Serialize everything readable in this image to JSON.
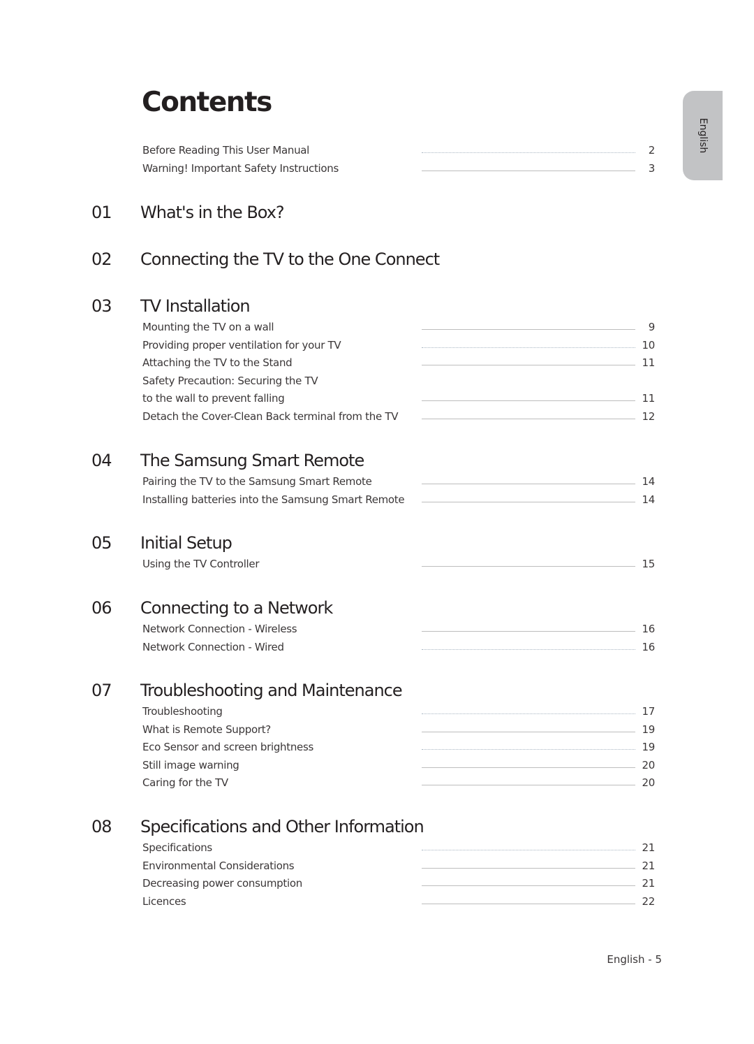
{
  "page": {
    "title": "Contents",
    "language_tab": "English",
    "footer": "English - 5"
  },
  "intro_entries": [
    {
      "label": "Before Reading This User Manual",
      "page": "2"
    },
    {
      "label": "Warning! Important Safety Instructions",
      "page": "3"
    }
  ],
  "chapters": [
    {
      "number": "01",
      "title": "What's in the Box?",
      "entries": []
    },
    {
      "number": "02",
      "title": "Connecting the TV to the One Connect",
      "entries": []
    },
    {
      "number": "03",
      "title": "TV Installation",
      "entries": [
        {
          "label": "Mounting the TV on a wall",
          "page": "9"
        },
        {
          "label": "Providing proper ventilation for your TV",
          "page": "10"
        },
        {
          "label": "Attaching the TV to the Stand",
          "page": "11"
        },
        {
          "label": "Safety Precaution: Securing the TV",
          "page": ""
        },
        {
          "label": "to the wall to prevent falling",
          "page": "11"
        },
        {
          "label": "Detach the Cover-Clean Back terminal from the TV",
          "page": "12"
        }
      ]
    },
    {
      "number": "04",
      "title": "The Samsung Smart Remote",
      "entries": [
        {
          "label": "Pairing the TV to the Samsung Smart Remote",
          "page": "14"
        },
        {
          "label": "Installing batteries into the Samsung Smart Remote",
          "page": "14"
        }
      ]
    },
    {
      "number": "05",
      "title": "Initial Setup",
      "entries": [
        {
          "label": "Using the TV Controller",
          "page": "15"
        }
      ]
    },
    {
      "number": "06",
      "title": "Connecting to a Network",
      "entries": [
        {
          "label": "Network Connection - Wireless",
          "page": "16"
        },
        {
          "label": "Network Connection - Wired",
          "page": "16"
        }
      ]
    },
    {
      "number": "07",
      "title": "Troubleshooting and Maintenance",
      "entries": [
        {
          "label": "Troubleshooting",
          "page": "17"
        },
        {
          "label": "What is Remote Support?",
          "page": "19"
        },
        {
          "label": "Eco Sensor and screen brightness",
          "page": "19"
        },
        {
          "label": "Still image warning",
          "page": "20"
        },
        {
          "label": "Caring for the TV",
          "page": "20"
        }
      ]
    },
    {
      "number": "08",
      "title": "Specifications and Other Information",
      "entries": [
        {
          "label": "Specifications",
          "page": "21"
        },
        {
          "label": "Environmental Considerations",
          "page": "21"
        },
        {
          "label": "Decreasing power consumption",
          "page": "21"
        },
        {
          "label": "Licences",
          "page": "22"
        }
      ]
    }
  ]
}
